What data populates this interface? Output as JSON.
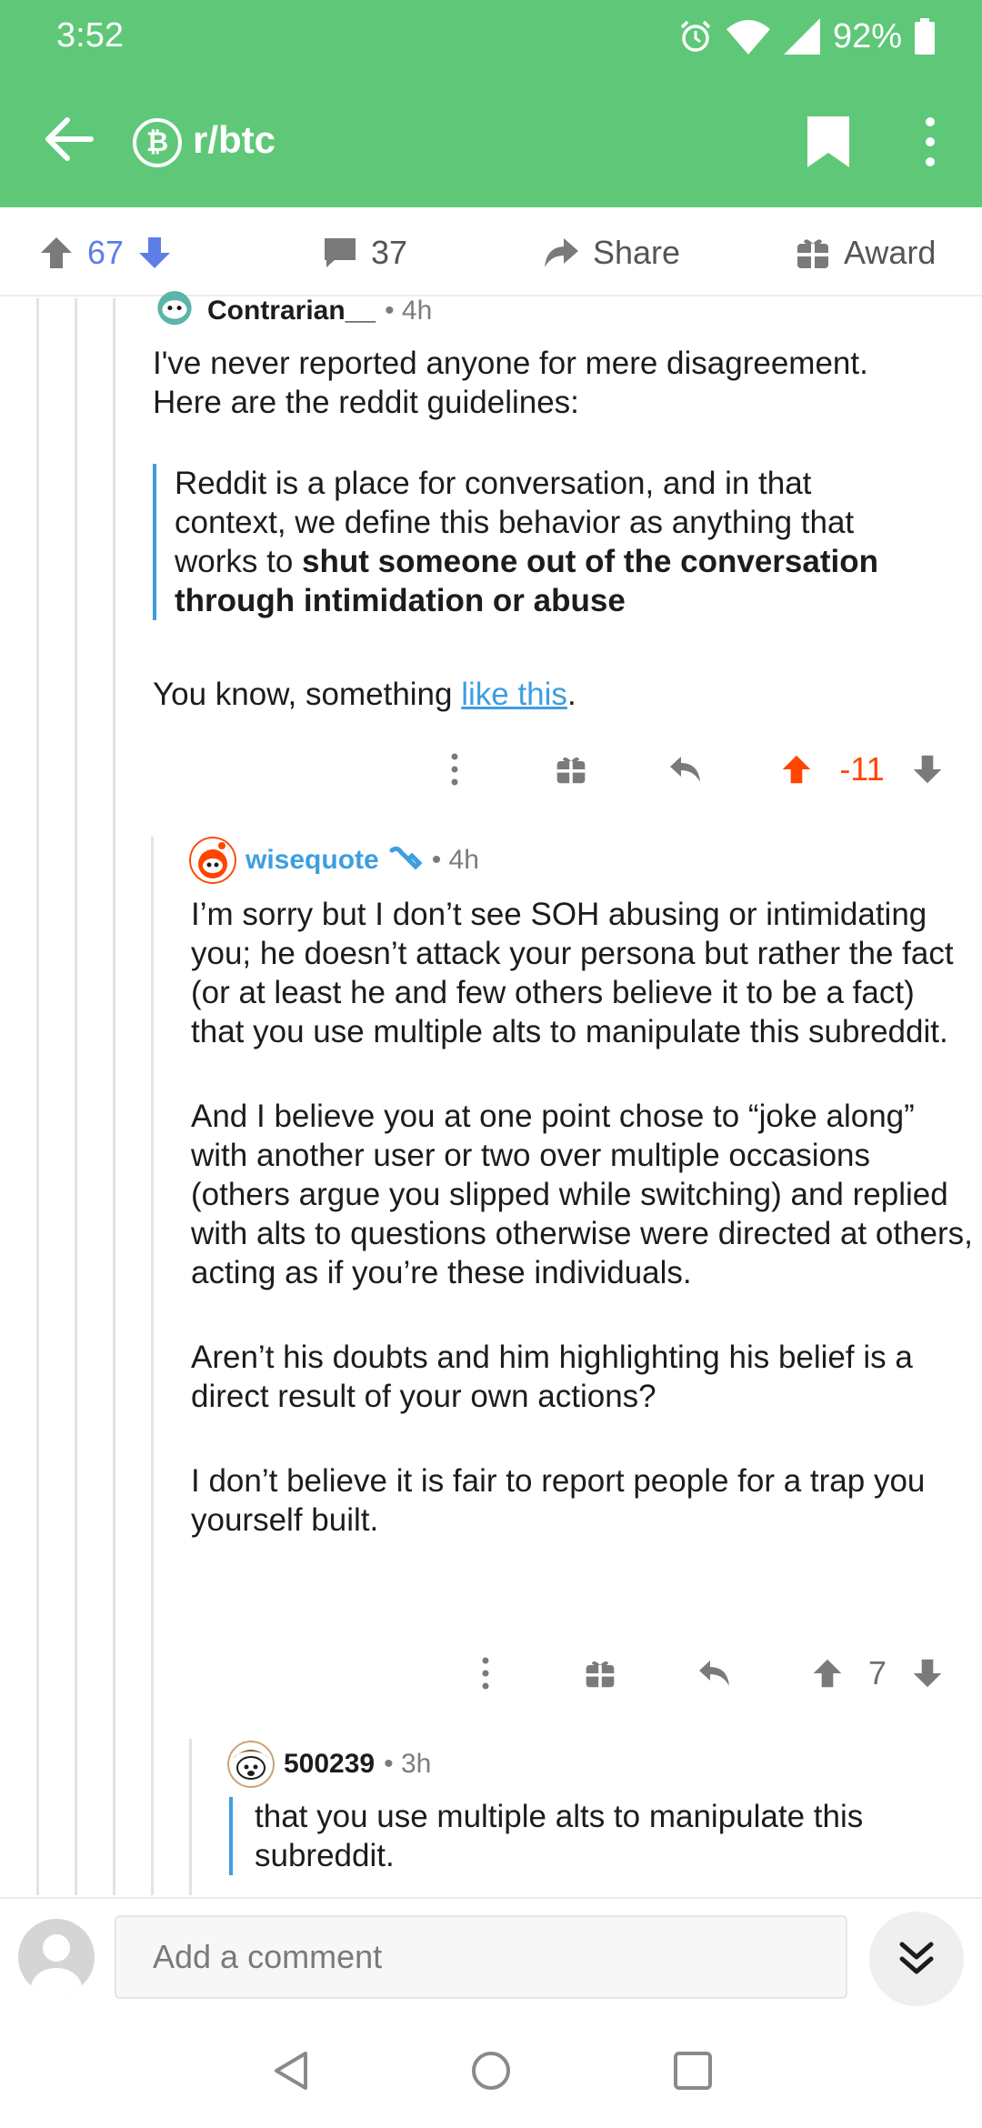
{
  "status_bar": {
    "time": "3:52",
    "battery": "92%"
  },
  "app_bar": {
    "subreddit": "r/btc",
    "sub_icon_glyph": "₿"
  },
  "post_actions": {
    "score": "67",
    "comments": "37",
    "share": "Share",
    "award": "Award"
  },
  "comments": [
    {
      "author": "Contrarian__",
      "age": "• 4h",
      "text_before_quote": "I've never reported anyone for mere disagreement. Here are the reddit guidelines:",
      "quote_plain": "Reddit is a place for conversation, and in that context, we define this behavior as anything that works to ",
      "quote_bold": "shut someone out of the conversation through intimidation or abuse",
      "text_after_prefix": "You know, something ",
      "link_text": "like this",
      "text_after_suffix": ".",
      "score": "-11"
    },
    {
      "author": "wisequote",
      "age": "• 4h",
      "paragraphs": [
        "I’m sorry but I don’t see SOH abusing or intimidating you; he doesn’t attack your persona but rather the fact (or at least he and few others believe it to be a fact) that you use multiple alts to manipulate this subreddit.",
        "And I believe you at one point chose to “joke along” with another user or two over multiple occasions (others argue you slipped while switching) and replied with alts to questions otherwise were directed at others, acting as if you’re these individuals.",
        "Aren’t his doubts and him highlighting his belief is a direct result of your own actions?",
        "I don’t believe it is fair to report people for a trap you yourself built."
      ],
      "score": "7"
    },
    {
      "author": "500239",
      "age": "• 3h",
      "quote": "that you use multiple alts to manipulate this subreddit."
    }
  ],
  "comment_bar": {
    "placeholder": "Add a comment"
  },
  "colors": {
    "app_green": "#5ec878",
    "upvote_active": "#ff4500",
    "mod_blue": "#3d9ee0",
    "score_blue": "#5d7ee8"
  }
}
